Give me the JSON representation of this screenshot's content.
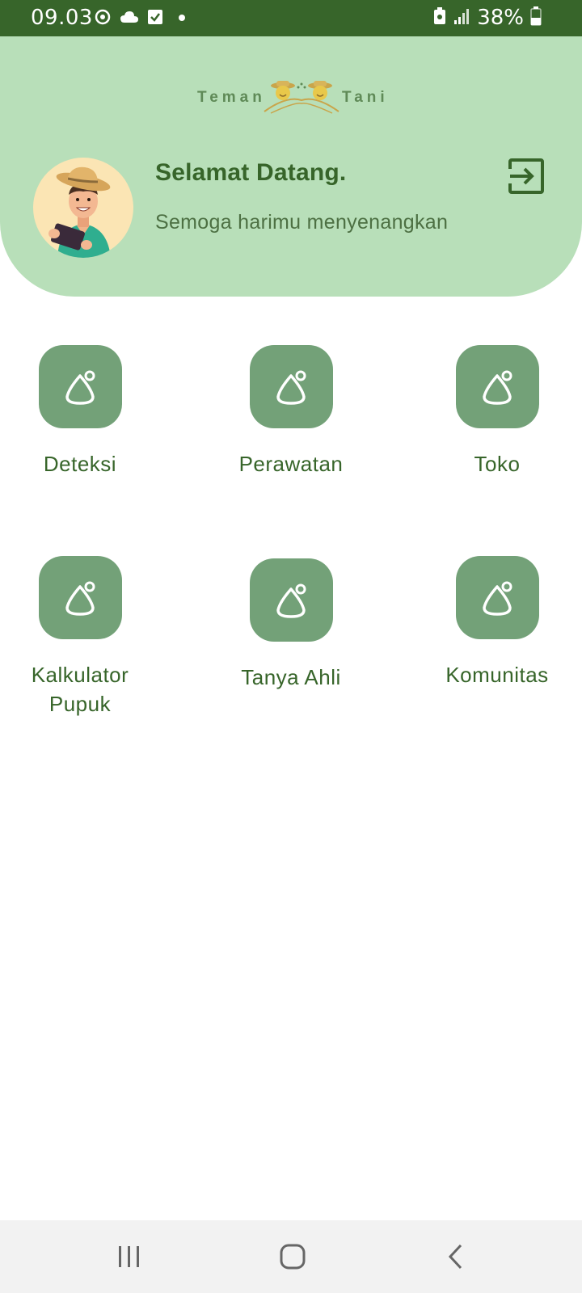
{
  "status_bar": {
    "time": "09.03",
    "battery": "38%",
    "icons_left": [
      "sync-icon",
      "cloud-icon",
      "checkbox-icon",
      "dot-icon"
    ],
    "icons_right": [
      "battery-saver-icon",
      "signal-icon",
      "battery-icon"
    ]
  },
  "header": {
    "logo_left": "Teman",
    "logo_right": "Tani",
    "welcome_title": "Selamat Datang.",
    "welcome_subtitle": "Semoga harimu menyenangkan",
    "logout_icon": "logout-icon",
    "avatar": "farmer-avatar"
  },
  "menu": {
    "items": [
      {
        "label": "Deteksi",
        "icon": "placeholder-icon"
      },
      {
        "label": "Perawatan",
        "icon": "placeholder-icon"
      },
      {
        "label": "Toko",
        "icon": "placeholder-icon"
      },
      {
        "label_line1": "Kalkulator",
        "label_line2": "Pupuk",
        "icon": "placeholder-icon"
      },
      {
        "label": "Tanya Ahli",
        "icon": "placeholder-icon"
      },
      {
        "label": "Komunitas",
        "icon": "placeholder-icon"
      }
    ]
  },
  "nav_bar": {
    "buttons": [
      "recent-apps-icon",
      "home-icon",
      "back-icon"
    ]
  },
  "colors": {
    "status_bar": "#37652a",
    "header_bg": "#b8dfb9",
    "accent": "#37652a",
    "menu_icon_bg": "#73a178",
    "nav_bg": "#f2f2f2"
  }
}
